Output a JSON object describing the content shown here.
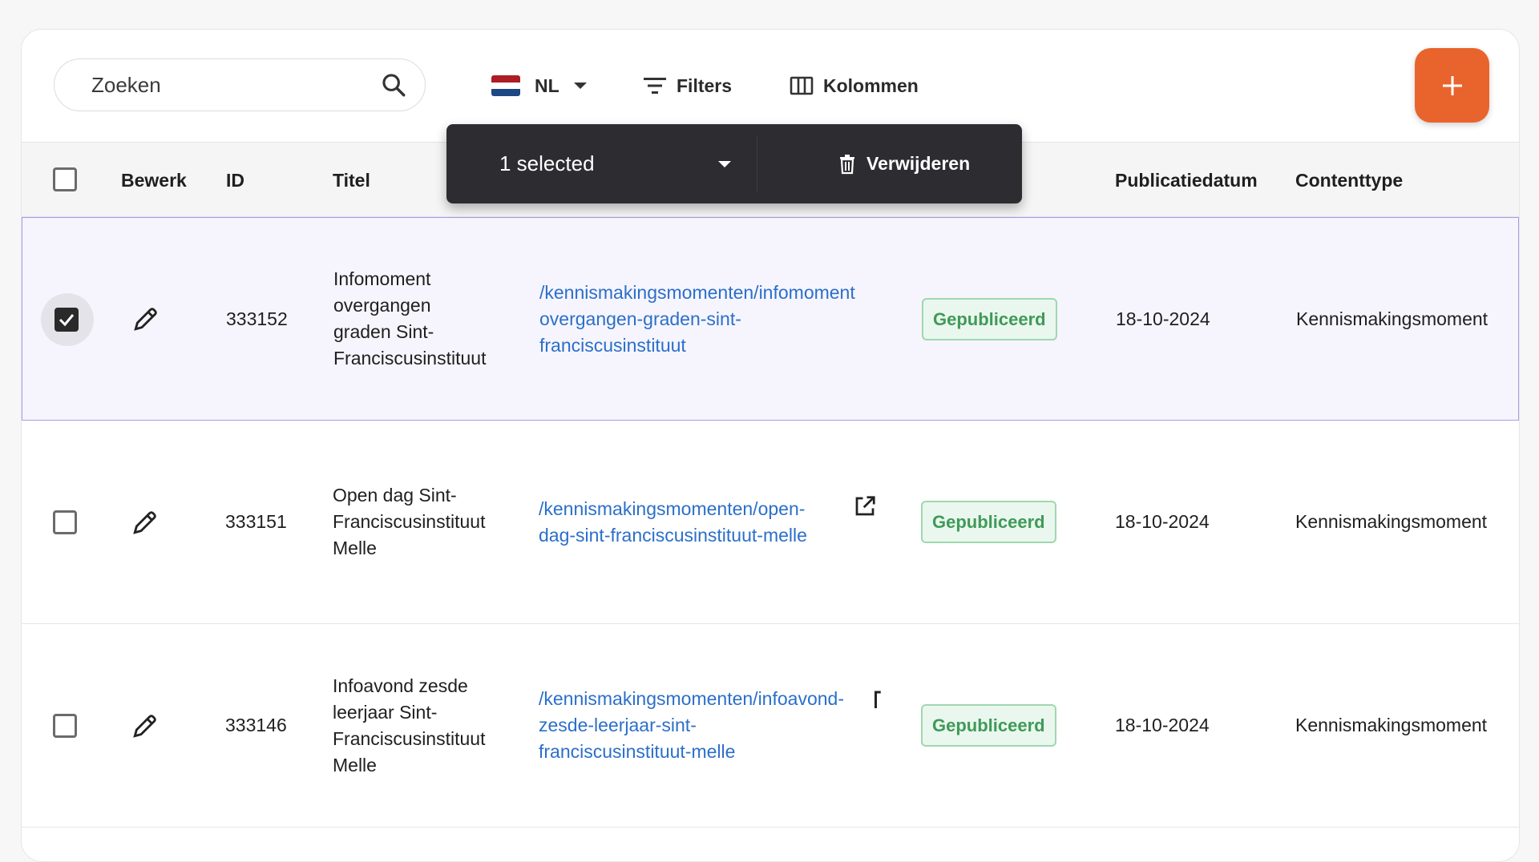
{
  "search": {
    "placeholder": "Zoeken"
  },
  "toolbar": {
    "language": "NL",
    "filters_label": "Filters",
    "columns_label": "Kolommen",
    "add_label": "+"
  },
  "colors": {
    "accent": "#e8642c",
    "link": "#2b6fc9",
    "published": "#3f9a58",
    "snackbar": "#2d2c30"
  },
  "table": {
    "headers": {
      "edit": "Bewerk",
      "id": "ID",
      "title": "Titel",
      "publication_date": "Publicatiedatum",
      "content_type": "Contenttype"
    },
    "rows": [
      {
        "selected": true,
        "id": "333152",
        "title_lines": [
          "Infomoment",
          "overgangen",
          "graden Sint-",
          "Franciscusinstituut"
        ],
        "url_lines": [
          "/kennismakingsmomenten/infomoment",
          "overgangen-graden-sint-",
          "franciscusinstituut"
        ],
        "status": "Gepubliceerd",
        "date": "18-10-2024",
        "content_type": "Kennismakingsmoment"
      },
      {
        "selected": false,
        "id": "333151",
        "title_lines": [
          "Open dag Sint-",
          "Franciscusinstituut",
          "Melle"
        ],
        "url_lines": [
          "/kennismakingsmomenten/open-",
          "dag-sint-franciscusinstituut-melle"
        ],
        "status": "Gepubliceerd",
        "date": "18-10-2024",
        "content_type": "Kennismakingsmoment"
      },
      {
        "selected": false,
        "id": "333146",
        "title_lines": [
          "Infoavond zesde",
          "leerjaar Sint-",
          "Franciscusinstituut",
          "Melle"
        ],
        "url_lines": [
          "/kennismakingsmomenten/infoavond-",
          "zesde-leerjaar-sint-",
          "franciscusinstituut-melle"
        ],
        "status": "Gepubliceerd",
        "date": "18-10-2024",
        "content_type": "Kennismakingsmoment"
      }
    ]
  },
  "selection_bar": {
    "selected_text": "1 selected",
    "delete_label": "Verwijderen"
  }
}
